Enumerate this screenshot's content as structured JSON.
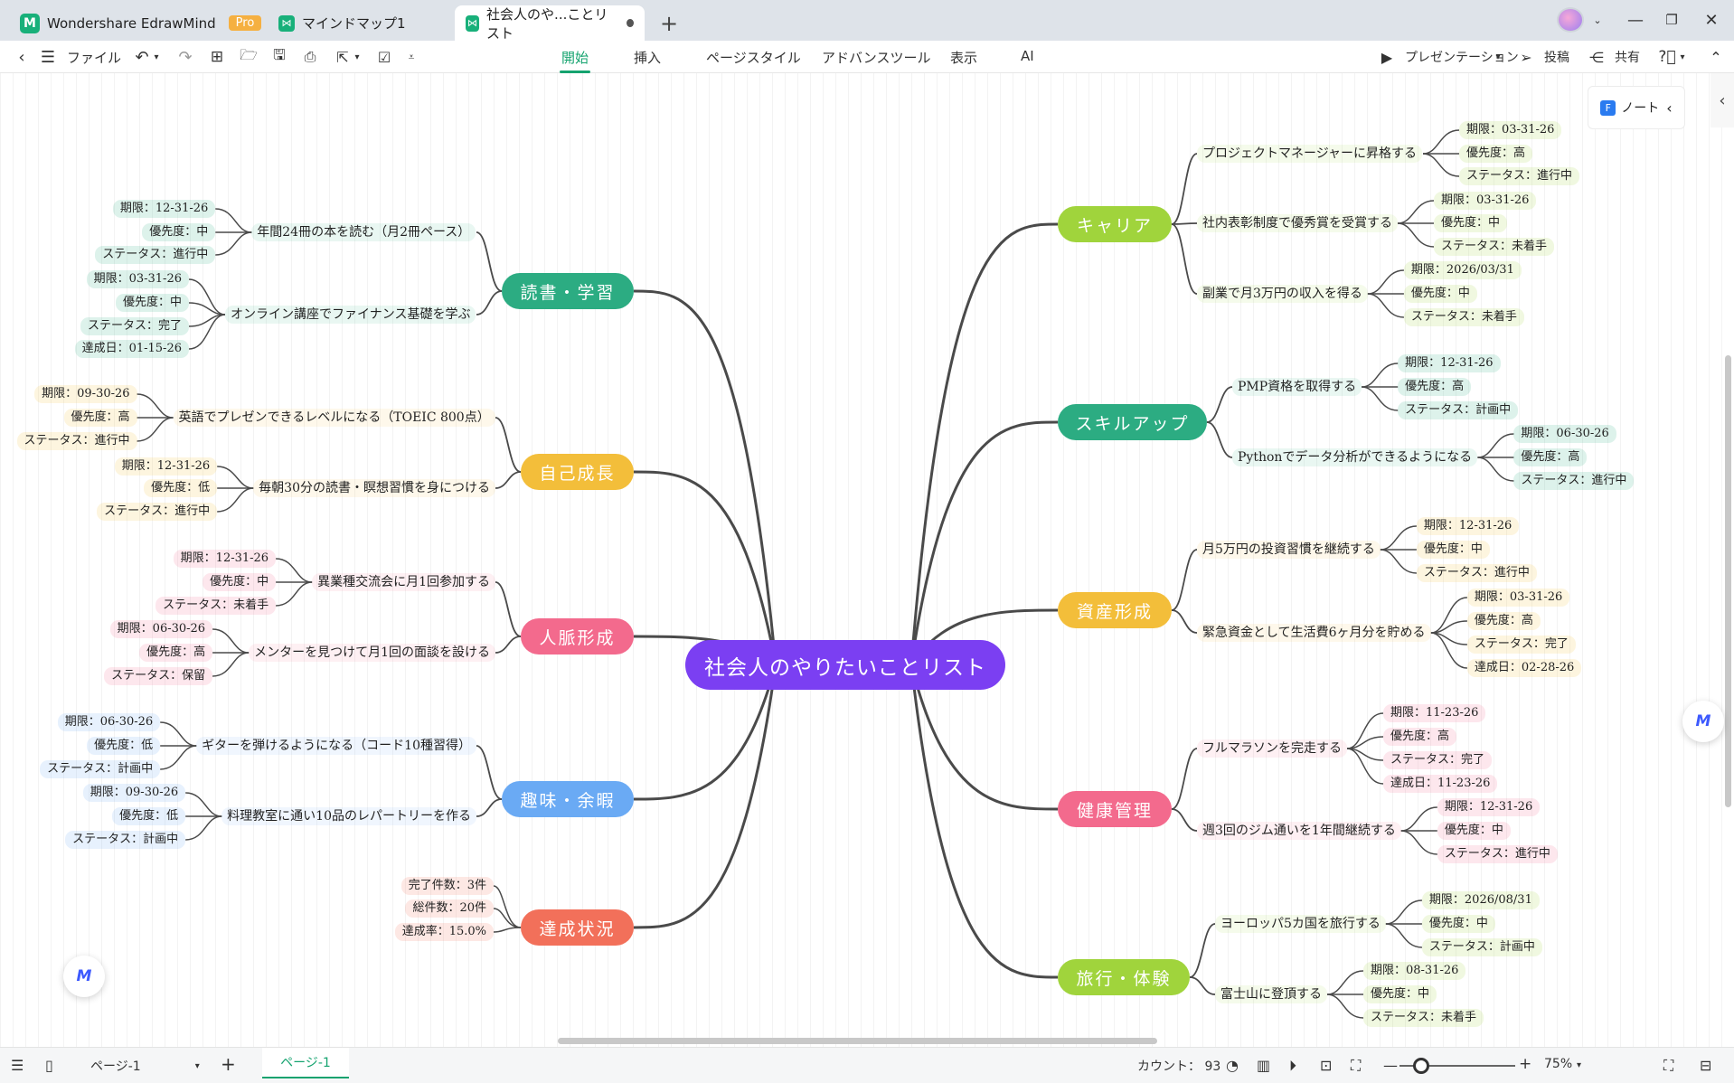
{
  "titlebar": {
    "app_name": "Wondershare EdrawMind",
    "pro_badge": "Pro",
    "tab1": "マインドマップ1",
    "tab2": "社会人のや...ことリスト",
    "new_tab": "+"
  },
  "toolbar": {
    "file": "ファイル",
    "menu_tabs": [
      "開始",
      "挿入",
      "ページスタイル",
      "アドバンスツール",
      "表示",
      "AI"
    ],
    "presentation": "プレゼンテーション",
    "post": "投稿",
    "share": "共有"
  },
  "mindmap": {
    "central": "社会人のやりたいことリスト",
    "topics": [
      {
        "label": "読書・学習",
        "color": "#2cac82",
        "subs": [
          {
            "label": "年間24冊の本を読む（月2冊ペース）",
            "leaves": [
              "期限：12-31-26",
              "優先度：中",
              "ステータス：進行中"
            ]
          },
          {
            "label": "オンライン講座でファイナンス基礎を学ぶ",
            "leaves": [
              "期限：03-31-26",
              "優先度：中",
              "ステータス：完了",
              "達成日：01-15-26"
            ]
          }
        ]
      },
      {
        "label": "自己成長",
        "color": "#f3be3a",
        "subs": [
          {
            "label": "英語でプレゼンできるレベルになる（TOEIC 800点）",
            "leaves": [
              "期限：09-30-26",
              "優先度：高",
              "ステータス：進行中"
            ]
          },
          {
            "label": "毎朝30分の読書・瞑想習慣を身につける",
            "leaves": [
              "期限：12-31-26",
              "優先度：低",
              "ステータス：進行中"
            ]
          }
        ]
      },
      {
        "label": "人脈形成",
        "color": "#f36a8d",
        "subs": [
          {
            "label": "異業種交流会に月1回参加する",
            "leaves": [
              "期限：12-31-26",
              "優先度：中",
              "ステータス：未着手"
            ]
          },
          {
            "label": "メンターを見つけて月1回の面談を設ける",
            "leaves": [
              "期限：06-30-26",
              "優先度：高",
              "ステータス：保留"
            ]
          }
        ]
      },
      {
        "label": "趣味・余暇",
        "color": "#6aaaf4",
        "subs": [
          {
            "label": "ギターを弾けるようになる（コード10種習得）",
            "leaves": [
              "期限：06-30-26",
              "優先度：低",
              "ステータス：計画中"
            ]
          },
          {
            "label": "料理教室に通い10品のレパートリーを作る",
            "leaves": [
              "期限：09-30-26",
              "優先度：低",
              "ステータス：計画中"
            ]
          }
        ]
      },
      {
        "label": "達成状況",
        "color": "#f2705a",
        "subs": [],
        "leaves": [
          "完了件数：3件",
          "総件数：20件",
          "達成率：15.0%"
        ]
      },
      {
        "label": "キャリア",
        "color": "#a0d43c",
        "subs": [
          {
            "label": "プロジェクトマネージャーに昇格する",
            "leaves": [
              "期限：03-31-26",
              "優先度：高",
              "ステータス：進行中"
            ]
          },
          {
            "label": "社内表彰制度で優秀賞を受賞する",
            "leaves": [
              "期限：03-31-26",
              "優先度：中",
              "ステータス：未着手"
            ]
          },
          {
            "label": "副業で月3万円の収入を得る",
            "leaves": [
              "期限：2026/03/31",
              "優先度：中",
              "ステータス：未着手"
            ]
          }
        ]
      },
      {
        "label": "スキルアップ",
        "color": "#2cac82",
        "subs": [
          {
            "label": "PMP資格を取得する",
            "leaves": [
              "期限：12-31-26",
              "優先度：高",
              "ステータス：計画中"
            ]
          },
          {
            "label": "Pythonでデータ分析ができるようになる",
            "leaves": [
              "期限：06-30-26",
              "優先度：高",
              "ステータス：進行中"
            ]
          }
        ]
      },
      {
        "label": "資産形成",
        "color": "#f3be3a",
        "subs": [
          {
            "label": "月5万円の投資習慣を継続する",
            "leaves": [
              "期限：12-31-26",
              "優先度：中",
              "ステータス：進行中"
            ]
          },
          {
            "label": "緊急資金として生活費6ヶ月分を貯める",
            "leaves": [
              "期限：03-31-26",
              "優先度：高",
              "ステータス：完了",
              "達成日：02-28-26"
            ]
          }
        ]
      },
      {
        "label": "健康管理",
        "color": "#f36a8d",
        "subs": [
          {
            "label": "フルマラソンを完走する",
            "leaves": [
              "期限：11-23-26",
              "優先度：高",
              "ステータス：完了",
              "達成日：11-23-26"
            ]
          },
          {
            "label": "週3回のジム通いを1年間継続する",
            "leaves": [
              "期限：12-31-26",
              "優先度：中",
              "ステータス：進行中"
            ]
          }
        ]
      },
      {
        "label": "旅行・体験",
        "color": "#a0d43c",
        "subs": [
          {
            "label": "ヨーロッパ5カ国を旅行する",
            "leaves": [
              "期限：2026/08/31",
              "優先度：中",
              "ステータス：計画中"
            ]
          },
          {
            "label": "富士山に登頂する",
            "leaves": [
              "期限：08-31-26",
              "優先度：中",
              "ステータス：未着手"
            ]
          }
        ]
      }
    ]
  },
  "side": {
    "note": "ノート"
  },
  "statusbar": {
    "page_select": "ページ-1",
    "page_tab": "ページ-1",
    "count": "カウント： 93",
    "zoom": "75%",
    "zoom_level": 0.19
  }
}
